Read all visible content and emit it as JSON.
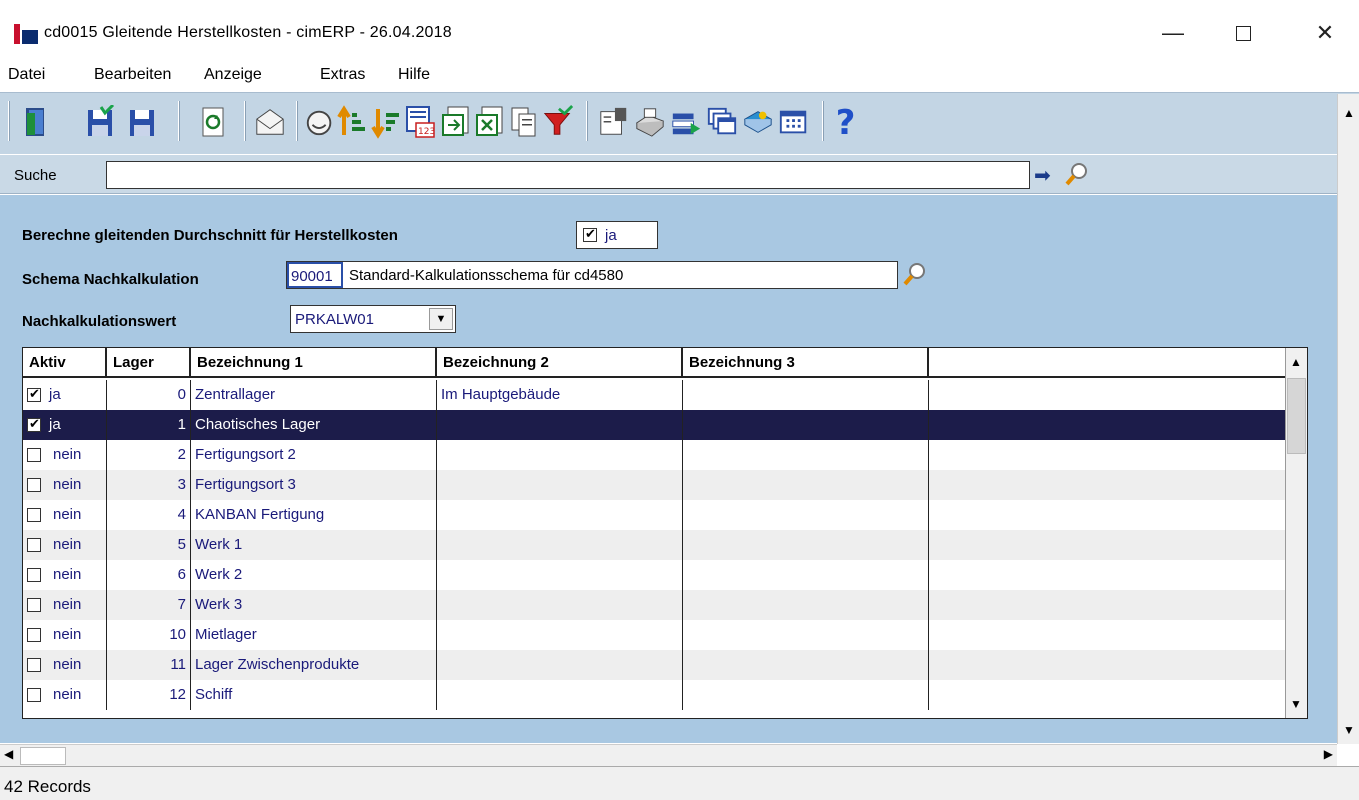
{
  "window": {
    "title": "cd0015 Gleitende Herstellkosten - cimERP - 26.04.2018"
  },
  "menu": [
    "Datei",
    "Bearbeiten",
    "Anzeige",
    "Extras",
    "Hilfe"
  ],
  "search": {
    "label": "Suche",
    "value": ""
  },
  "form": {
    "gleitend_label": "Berechne gleitenden Durchschnitt für Herstellkosten",
    "gleitend_checked": true,
    "gleitend_value": "ja",
    "schema_label": "Schema Nachkalkulation",
    "schema_code": "90001",
    "schema_name": "Standard-Kalkulationsschema für cd4580",
    "wert_label": "Nachkalkulationswert",
    "wert_value": "PRKALW01"
  },
  "grid": {
    "columns": [
      "Aktiv",
      "Lager",
      "Bezeichnung 1",
      "Bezeichnung 2",
      "Bezeichnung 3",
      ""
    ],
    "rows": [
      {
        "aktiv": true,
        "aktiv_text": "ja",
        "lager": "0",
        "bez1": "Zentrallager",
        "bez2": "Im Hauptgebäude",
        "bez3": ""
      },
      {
        "aktiv": true,
        "aktiv_text": "ja",
        "lager": "1",
        "bez1": "Chaotisches Lager",
        "bez2": "",
        "bez3": "",
        "selected": true
      },
      {
        "aktiv": false,
        "aktiv_text": "nein",
        "lager": "2",
        "bez1": "Fertigungsort 2",
        "bez2": "",
        "bez3": ""
      },
      {
        "aktiv": false,
        "aktiv_text": "nein",
        "lager": "3",
        "bez1": "Fertigungsort 3",
        "bez2": "",
        "bez3": ""
      },
      {
        "aktiv": false,
        "aktiv_text": "nein",
        "lager": "4",
        "bez1": "KANBAN Fertigung",
        "bez2": "",
        "bez3": ""
      },
      {
        "aktiv": false,
        "aktiv_text": "nein",
        "lager": "5",
        "bez1": "Werk 1",
        "bez2": "",
        "bez3": ""
      },
      {
        "aktiv": false,
        "aktiv_text": "nein",
        "lager": "6",
        "bez1": "Werk 2",
        "bez2": "",
        "bez3": ""
      },
      {
        "aktiv": false,
        "aktiv_text": "nein",
        "lager": "7",
        "bez1": "Werk 3",
        "bez2": "",
        "bez3": ""
      },
      {
        "aktiv": false,
        "aktiv_text": "nein",
        "lager": "10",
        "bez1": "Mietlager",
        "bez2": "",
        "bez3": ""
      },
      {
        "aktiv": false,
        "aktiv_text": "nein",
        "lager": "11",
        "bez1": "Lager Zwischenprodukte",
        "bez2": "",
        "bez3": ""
      },
      {
        "aktiv": false,
        "aktiv_text": "nein",
        "lager": "12",
        "bez1": "Schiff",
        "bez2": "",
        "bez3": ""
      }
    ]
  },
  "status": {
    "records": "42 Records"
  },
  "colors": {
    "panel": "#a9c8e2",
    "toolbar": "#c3d5e4",
    "selected_row": "#1c1c4a",
    "text_blue": "#1a1a7a"
  },
  "toolbar_icons": [
    "exit-icon",
    "save-close-icon",
    "save-icon",
    "refresh-icon",
    "mail-icon",
    "sort-ascending-icon",
    "sort-descending-icon",
    "number-format-icon",
    "export-icon",
    "excel-icon",
    "copy-icon",
    "filter-icon",
    "properties-icon",
    "print-icon",
    "print-list-icon",
    "windows-icon",
    "book-icon",
    "table-icon",
    "help-icon"
  ]
}
